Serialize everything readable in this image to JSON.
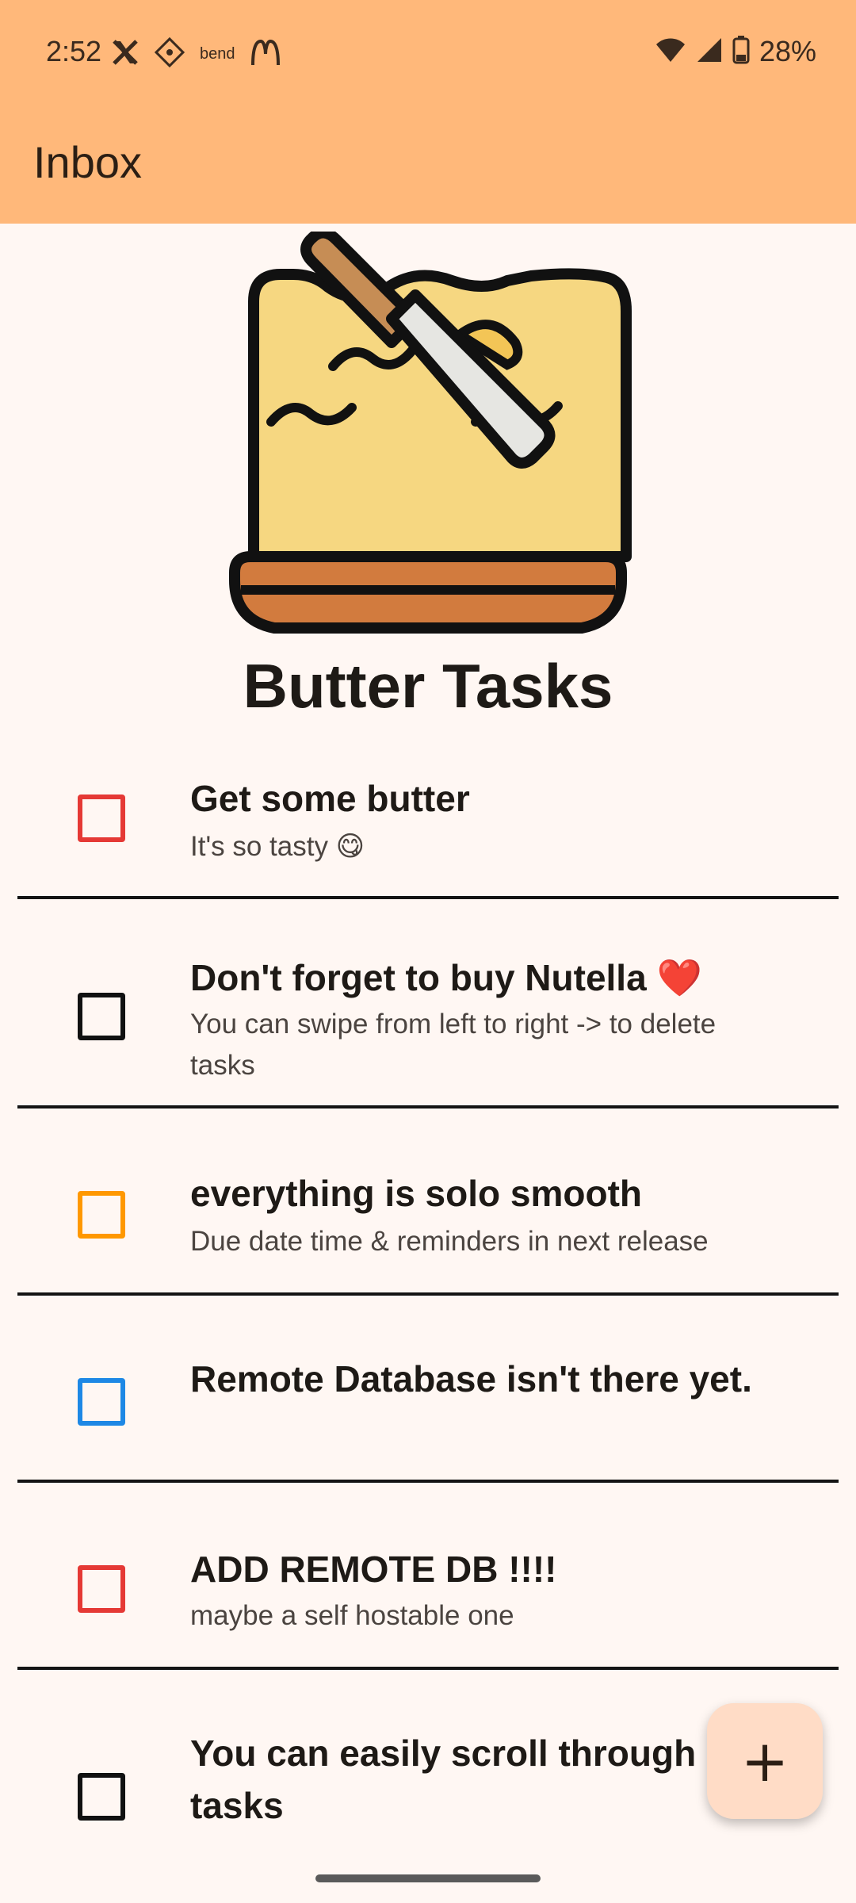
{
  "status_bar": {
    "time": "2:52",
    "notification_icons": [
      "x-icon",
      "app-icon",
      "bend-icon",
      "mcdonalds-icon"
    ],
    "bend_text": "bend",
    "battery": "28%"
  },
  "app_bar": {
    "title": "Inbox"
  },
  "hero": {
    "app_name": "Butter Tasks"
  },
  "tasks": [
    {
      "title": "Get some butter",
      "subtitle": "It's so tasty 😋",
      "checkbox_color": "#E53935"
    },
    {
      "title": "Don't forget to buy Nutella ❤️",
      "subtitle": "You can swipe from left to right -> to delete tasks",
      "checkbox_color": "#111111"
    },
    {
      "title": "everything is solo smooth",
      "subtitle": "Due date time & reminders in next release",
      "checkbox_color": "#FF9800"
    },
    {
      "title": "Remote Database isn't there yet.",
      "subtitle": "",
      "checkbox_color": "#1E88E5"
    },
    {
      "title": "ADD REMOTE DB !!!!",
      "subtitle": "maybe a self hostable one",
      "checkbox_color": "#E53935"
    },
    {
      "title": "You can easily scroll through tasks",
      "subtitle": "",
      "checkbox_color": "#111111"
    }
  ],
  "fab": {
    "icon": "plus-icon",
    "label": "+"
  }
}
